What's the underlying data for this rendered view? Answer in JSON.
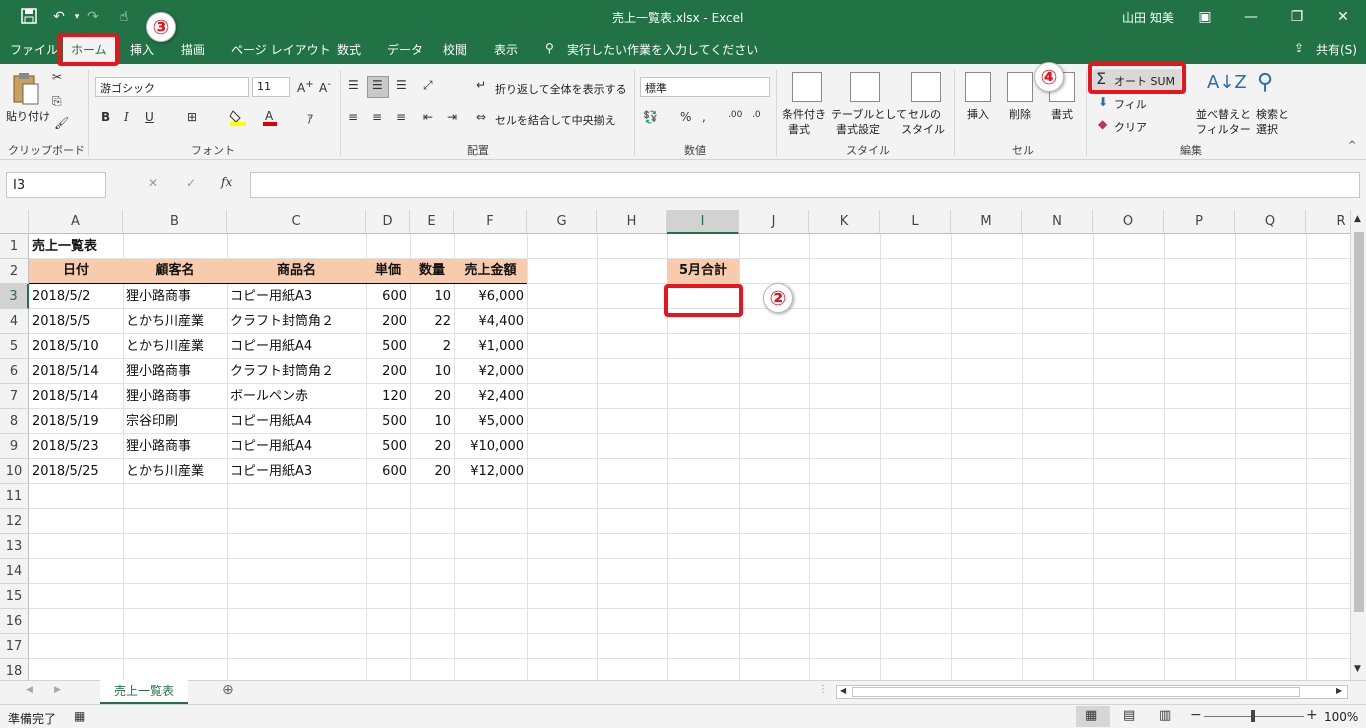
{
  "window": {
    "title": "売上一覧表.xlsx  -  Excel",
    "user": "山田 知美",
    "share": "共有(S)"
  },
  "tabs": [
    "ファイル",
    "ホーム",
    "挿入",
    "描画",
    "ページ レイアウト",
    "数式",
    "データ",
    "校閲",
    "表示"
  ],
  "tell_me": "実行したい作業を入力してください",
  "ribbon": {
    "clipboard": {
      "paste": "貼り付け",
      "label": "クリップボード"
    },
    "font": {
      "name": "游ゴシック",
      "size": "11",
      "label": "フォント",
      "bold": "B",
      "italic": "I",
      "underline": "U"
    },
    "alignment": {
      "wrap": "折り返して全体を表示する",
      "merge": "セルを結合して中央揃え",
      "label": "配置"
    },
    "number": {
      "format": "標準",
      "label": "数値"
    },
    "styles": {
      "cond1": "条件付き",
      "cond2": "書式",
      "table1": "テーブルとして",
      "table2": "書式設定",
      "cell1": "セルの",
      "cell2": "スタイル",
      "label": "スタイル"
    },
    "cells": {
      "insert": "挿入",
      "delete": "削除",
      "format": "書式",
      "label": "セル"
    },
    "editing": {
      "autosum": "オート SUM",
      "fill": "フィル",
      "clear": "クリア",
      "sort1": "並べ替えと",
      "sort2": "フィルター",
      "find1": "検索と",
      "find2": "選択",
      "label": "編集"
    }
  },
  "formula_bar": {
    "name_box": "I3",
    "fx": "fx",
    "formula": ""
  },
  "columns": [
    "A",
    "B",
    "C",
    "D",
    "E",
    "F",
    "G",
    "H",
    "I",
    "J",
    "K",
    "L",
    "M",
    "N",
    "O",
    "P",
    "Q",
    "R"
  ],
  "rows": [
    "1",
    "2",
    "3",
    "4",
    "5",
    "6",
    "7",
    "8",
    "9",
    "10",
    "11",
    "12",
    "13",
    "14",
    "15",
    "16",
    "17",
    "18"
  ],
  "sheet": {
    "title": "売上一覧表",
    "headers": [
      "日付",
      "顧客名",
      "商品名",
      "単価",
      "数量",
      "売上金額"
    ],
    "data": [
      [
        "2018/5/2",
        "狸小路商事",
        "コピー用紙A3",
        "600",
        "10",
        "¥6,000"
      ],
      [
        "2018/5/5",
        "とかち川産業",
        "クラフト封筒角２",
        "200",
        "22",
        "¥4,400"
      ],
      [
        "2018/5/10",
        "とかち川産業",
        "コピー用紙A4",
        "500",
        "2",
        "¥1,000"
      ],
      [
        "2018/5/14",
        "狸小路商事",
        "クラフト封筒角２",
        "200",
        "10",
        "¥2,000"
      ],
      [
        "2018/5/14",
        "狸小路商事",
        "ボールペン赤",
        "120",
        "20",
        "¥2,400"
      ],
      [
        "2018/5/19",
        "宗谷印刷",
        "コピー用紙A4",
        "500",
        "10",
        "¥5,000"
      ],
      [
        "2018/5/23",
        "狸小路商事",
        "コピー用紙A4",
        "500",
        "20",
        "¥10,000"
      ],
      [
        "2018/5/25",
        "とかち川産業",
        "コピー用紙A3",
        "600",
        "20",
        "¥12,000"
      ]
    ],
    "i2_label": "5月合計"
  },
  "sheet_tab": "売上一覧表",
  "status": {
    "ready": "準備完了",
    "zoom": "100%"
  },
  "callouts": {
    "c2": "②",
    "c3": "③",
    "c4": "④"
  },
  "colors": {
    "excel_green": "#217346",
    "header_fill": "#f8cbad",
    "callout_red": "#e8131c"
  }
}
